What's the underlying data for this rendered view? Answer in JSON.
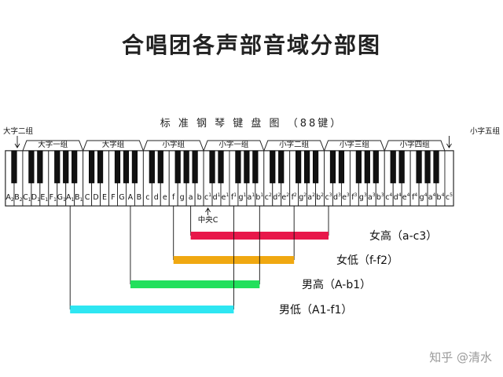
{
  "title": "合唱团各声部音域分部图",
  "keyboard_title": "标 准 钢 琴 键 盘 图 （88键）",
  "end_labels": {
    "left": "大字二组",
    "right": "小字五组"
  },
  "groups": [
    {
      "label": "大字一组"
    },
    {
      "label": "大字组"
    },
    {
      "label": "小字组"
    },
    {
      "label": "小字一组"
    },
    {
      "label": "小字二组"
    },
    {
      "label": "小字三组"
    },
    {
      "label": "小字四组"
    }
  ],
  "white_keys": [
    [
      "A",
      "2"
    ],
    [
      "B",
      "2"
    ],
    [
      "C",
      "1"
    ],
    [
      "D",
      "1"
    ],
    [
      "E",
      "1"
    ],
    [
      "F",
      "1"
    ],
    [
      "G",
      "1"
    ],
    [
      "A",
      "1"
    ],
    [
      "B",
      "1"
    ],
    [
      "C",
      ""
    ],
    [
      "D",
      ""
    ],
    [
      "E",
      ""
    ],
    [
      "F",
      ""
    ],
    [
      "G",
      ""
    ],
    [
      "A",
      ""
    ],
    [
      "B",
      ""
    ],
    [
      "c",
      ""
    ],
    [
      "d",
      ""
    ],
    [
      "e",
      ""
    ],
    [
      "f",
      ""
    ],
    [
      "g",
      ""
    ],
    [
      "a",
      ""
    ],
    [
      "b",
      ""
    ],
    [
      "c",
      "1"
    ],
    [
      "d",
      "1"
    ],
    [
      "e",
      "1"
    ],
    [
      "f",
      "1"
    ],
    [
      "g",
      "1"
    ],
    [
      "a",
      "1"
    ],
    [
      "b",
      "1"
    ],
    [
      "c",
      "2"
    ],
    [
      "d",
      "2"
    ],
    [
      "e",
      "2"
    ],
    [
      "f",
      "2"
    ],
    [
      "g",
      "2"
    ],
    [
      "a",
      "2"
    ],
    [
      "b",
      "2"
    ],
    [
      "c",
      "3"
    ],
    [
      "d",
      "3"
    ],
    [
      "e",
      "3"
    ],
    [
      "f",
      "3"
    ],
    [
      "g",
      "3"
    ],
    [
      "a",
      "3"
    ],
    [
      "b",
      "3"
    ],
    [
      "c",
      "4"
    ],
    [
      "d",
      "4"
    ],
    [
      "e",
      "4"
    ],
    [
      "f",
      "4"
    ],
    [
      "g",
      "4"
    ],
    [
      "a",
      "4"
    ],
    [
      "b",
      "4"
    ],
    [
      "c",
      "5"
    ]
  ],
  "middle_c_label": "中央C",
  "ranges": [
    {
      "label": "女高（a-c3）",
      "from_key": 21,
      "to_key": 37,
      "color": "#e8174a"
    },
    {
      "label": "女低（f-f2）",
      "from_key": 19,
      "to_key": 33,
      "color": "#f0a811"
    },
    {
      "label": "男高（A-b1）",
      "from_key": 14,
      "to_key": 29,
      "color": "#22e05c"
    },
    {
      "label": "男低（A1-f1）",
      "from_key": 7,
      "to_key": 26,
      "color": "#2ee6f2"
    }
  ],
  "watermark": "知乎 @清水"
}
